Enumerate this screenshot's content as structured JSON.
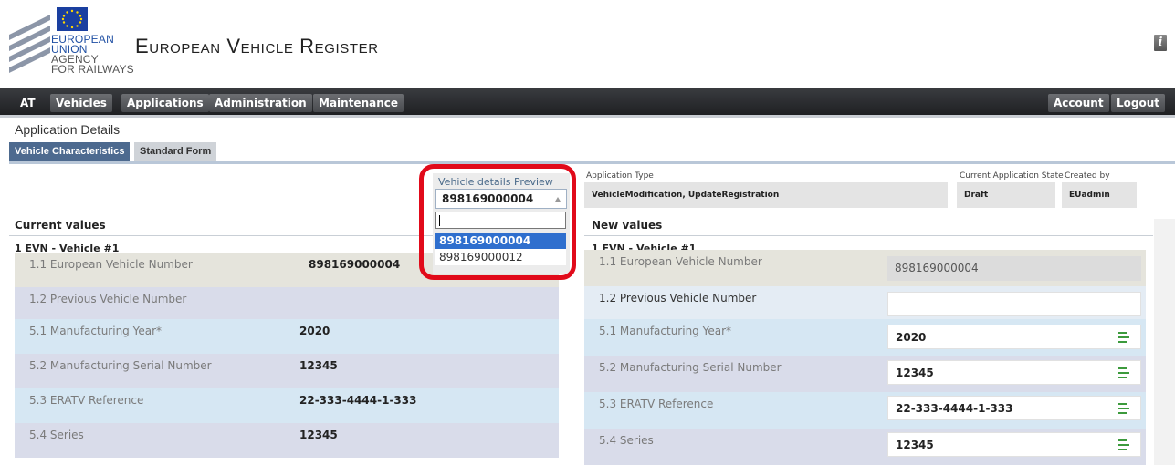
{
  "brand": {
    "logo_lines": [
      "EUROPEAN",
      "UNION",
      "AGENCY",
      "FOR RAILWAYS"
    ],
    "app_title": "European Vehicle Register",
    "info_icon": "i"
  },
  "nav": {
    "left": [
      "AT",
      "Vehicles",
      "Applications",
      "Administration",
      "Maintenance"
    ],
    "right": [
      "Account",
      "Logout"
    ]
  },
  "page": {
    "title": "Application Details",
    "tabs": [
      "Vehicle Characteristics",
      "Standard Form"
    ]
  },
  "meta": {
    "application_type_label": "Application Type",
    "application_type_value": "VehicleModification, UpdateRegistration",
    "state_label": "Current Application State",
    "state_value": "Draft",
    "created_by_label": "Created by",
    "created_by_value": "EUadmin"
  },
  "preview": {
    "label": "Vehicle details Preview",
    "selected": "898169000004",
    "options": [
      "898169000004",
      "898169000012"
    ]
  },
  "current": {
    "heading": "Current values",
    "group": "1 EVN - Vehicle #1",
    "rows": [
      {
        "label": "1.1 European Vehicle Number",
        "value": "898169000004"
      },
      {
        "label": "1.2 Previous Vehicle Number",
        "value": ""
      },
      {
        "label": "5.1 Manufacturing Year*",
        "value": "2020"
      },
      {
        "label": "5.2 Manufacturing Serial Number",
        "value": "12345"
      },
      {
        "label": "5.3 ERATV Reference",
        "value": "22-333-4444-1-333"
      },
      {
        "label": "5.4 Series",
        "value": "12345"
      }
    ]
  },
  "new": {
    "heading": "New values",
    "group": "1 EVN - Vehicle #1",
    "rows": [
      {
        "label": "1.1 European Vehicle Number",
        "value": "898169000004"
      },
      {
        "label": "1.2 Previous Vehicle Number",
        "value": ""
      },
      {
        "label": "5.1 Manufacturing Year*",
        "value": "2020"
      },
      {
        "label": "5.2 Manufacturing Serial Number",
        "value": "12345"
      },
      {
        "label": "5.3 ERATV Reference",
        "value": "22-333-4444-1-333"
      },
      {
        "label": "5.4 Series",
        "value": "12345"
      }
    ]
  },
  "colors": {
    "highlight": "#e10a1a",
    "selected_option": "#2f6fce",
    "copy_icon": "#3c9a3c"
  }
}
